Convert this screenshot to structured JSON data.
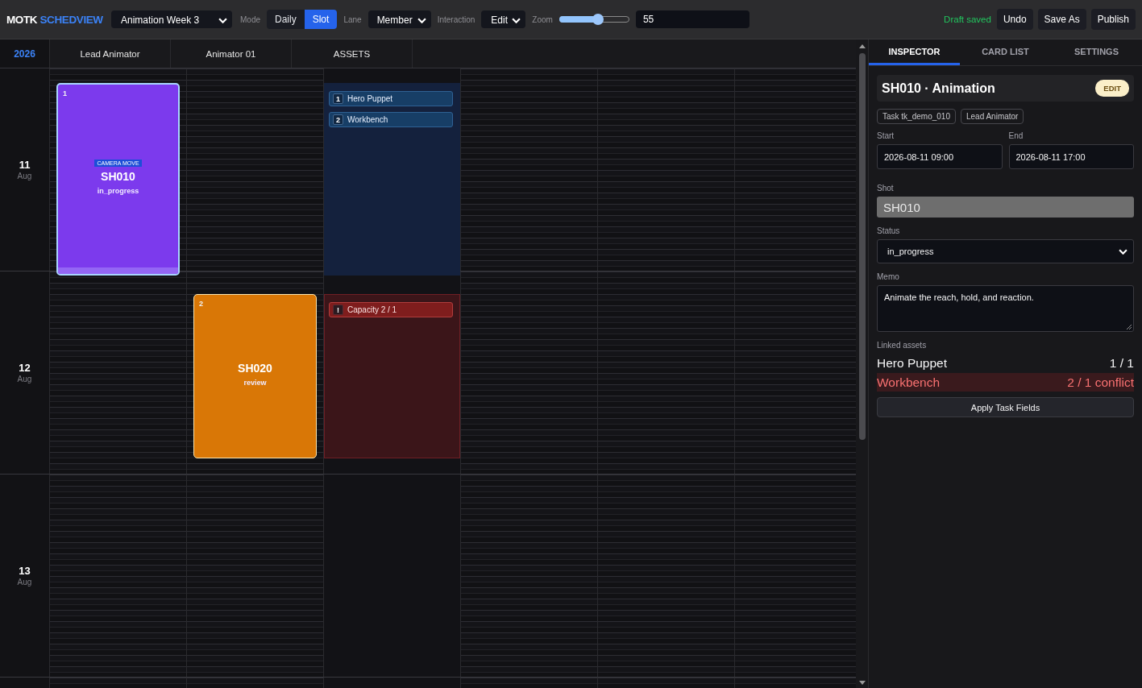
{
  "toolbar": {
    "logo": {
      "brand": "MOTK",
      "product": "SCHEDVIEW"
    },
    "schedule": {
      "value": "Animation Week 3"
    },
    "mode": {
      "label": "Mode",
      "options": [
        {
          "label": "Daily",
          "selected": false
        },
        {
          "label": "Slot",
          "selected": true
        }
      ]
    },
    "lane": {
      "label": "Lane",
      "value": "Member"
    },
    "interaction": {
      "label": "Interaction",
      "value": "Edit"
    },
    "zoom": {
      "label": "Zoom",
      "level": 0.55,
      "value": "55"
    },
    "save_status": "Draft saved",
    "buttons": [
      "Undo",
      "Save As",
      "Publish"
    ]
  },
  "calendar": {
    "year": "2026",
    "lanes": [
      {
        "label": "Lead Animator",
        "kind": "member"
      },
      {
        "label": "Animator 01",
        "kind": "member"
      },
      {
        "label": "ASSETS",
        "kind": "assets"
      }
    ],
    "days": [
      {
        "day": "11",
        "month": "Aug",
        "cells": [
          {
            "kind": "card",
            "number": "1",
            "color": "#7c3aed",
            "selected": true,
            "tags": [
              "CAMERA MOVE"
            ],
            "title": "SH010",
            "status": "in_progress"
          },
          {
            "kind": "empty"
          },
          {
            "kind": "assets",
            "conflict": false,
            "items": [
              {
                "kind": "asset",
                "badge": "1",
                "label": "Hero Puppet"
              },
              {
                "kind": "asset",
                "badge": "2",
                "label": "Workbench"
              }
            ]
          }
        ]
      },
      {
        "day": "12",
        "month": "Aug",
        "cells": [
          {
            "kind": "empty"
          },
          {
            "kind": "card",
            "number": "2",
            "color": "#d97706",
            "selected": false,
            "title": "SH020",
            "status": "review"
          },
          {
            "kind": "assets",
            "conflict": true,
            "items": [
              {
                "kind": "warning",
                "badge": "!",
                "label": "Capacity 2 / 1"
              }
            ]
          }
        ]
      },
      {
        "day": "13",
        "month": "Aug"
      }
    ]
  },
  "panel": {
    "tabs": [
      {
        "label": "INSPECTOR",
        "selected": true
      },
      {
        "label": "CARD LIST",
        "selected": false
      },
      {
        "label": "SETTINGS",
        "selected": false
      }
    ],
    "inspector": {
      "title": "SH010 · Animation",
      "mode_badge": "EDIT",
      "chips": [
        "Task tk_demo_010",
        "Lead Animator"
      ],
      "start": {
        "label": "Start",
        "value": "2026-08-11 09:00"
      },
      "end": {
        "label": "End",
        "value": "2026-08-11 17:00"
      },
      "shot": {
        "label": "Shot",
        "value": "SH010",
        "disabled": true
      },
      "status": {
        "label": "Status",
        "value": "in_progress"
      },
      "memo": {
        "label": "Memo",
        "value": "Animate the reach, hold, and reaction."
      },
      "linked_assets": {
        "label": "Linked assets",
        "items": [
          {
            "name": "Hero Puppet",
            "usage": "1 / 1",
            "conflict": false
          },
          {
            "name": "Workbench",
            "usage": "2 / 1 conflict",
            "conflict": true
          }
        ]
      },
      "apply_button": "Apply Task Fields"
    }
  }
}
